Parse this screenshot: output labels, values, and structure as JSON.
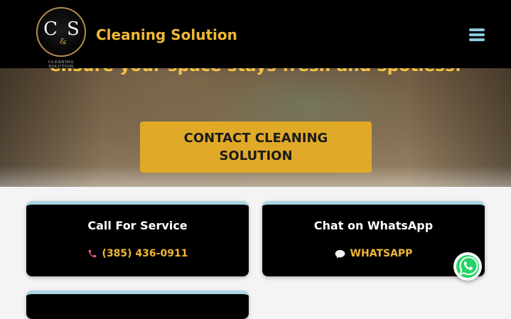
{
  "header": {
    "logo_text": "C&S",
    "logo_caption": "CLEANING SOLUTION",
    "brand": "Cleaning Solution",
    "menu_icon": "hamburger-menu-icon"
  },
  "hero": {
    "text": "ensure your space stays fresh and spotless.",
    "cta_label": "CONTACT CLEANING SOLUTION"
  },
  "cards": [
    {
      "title": "Call For Service",
      "link_label": "(385) 436-0911",
      "icon": "phone-icon"
    },
    {
      "title": "Chat on WhatsApp",
      "link_label": "WHATSAPP",
      "icon": "chat-bubble-icon"
    }
  ],
  "colors": {
    "accent": "#f1b734",
    "cta_bg": "#e0a928",
    "card_top_border": "#a9d6e2",
    "whatsapp_green": "#25d366"
  }
}
